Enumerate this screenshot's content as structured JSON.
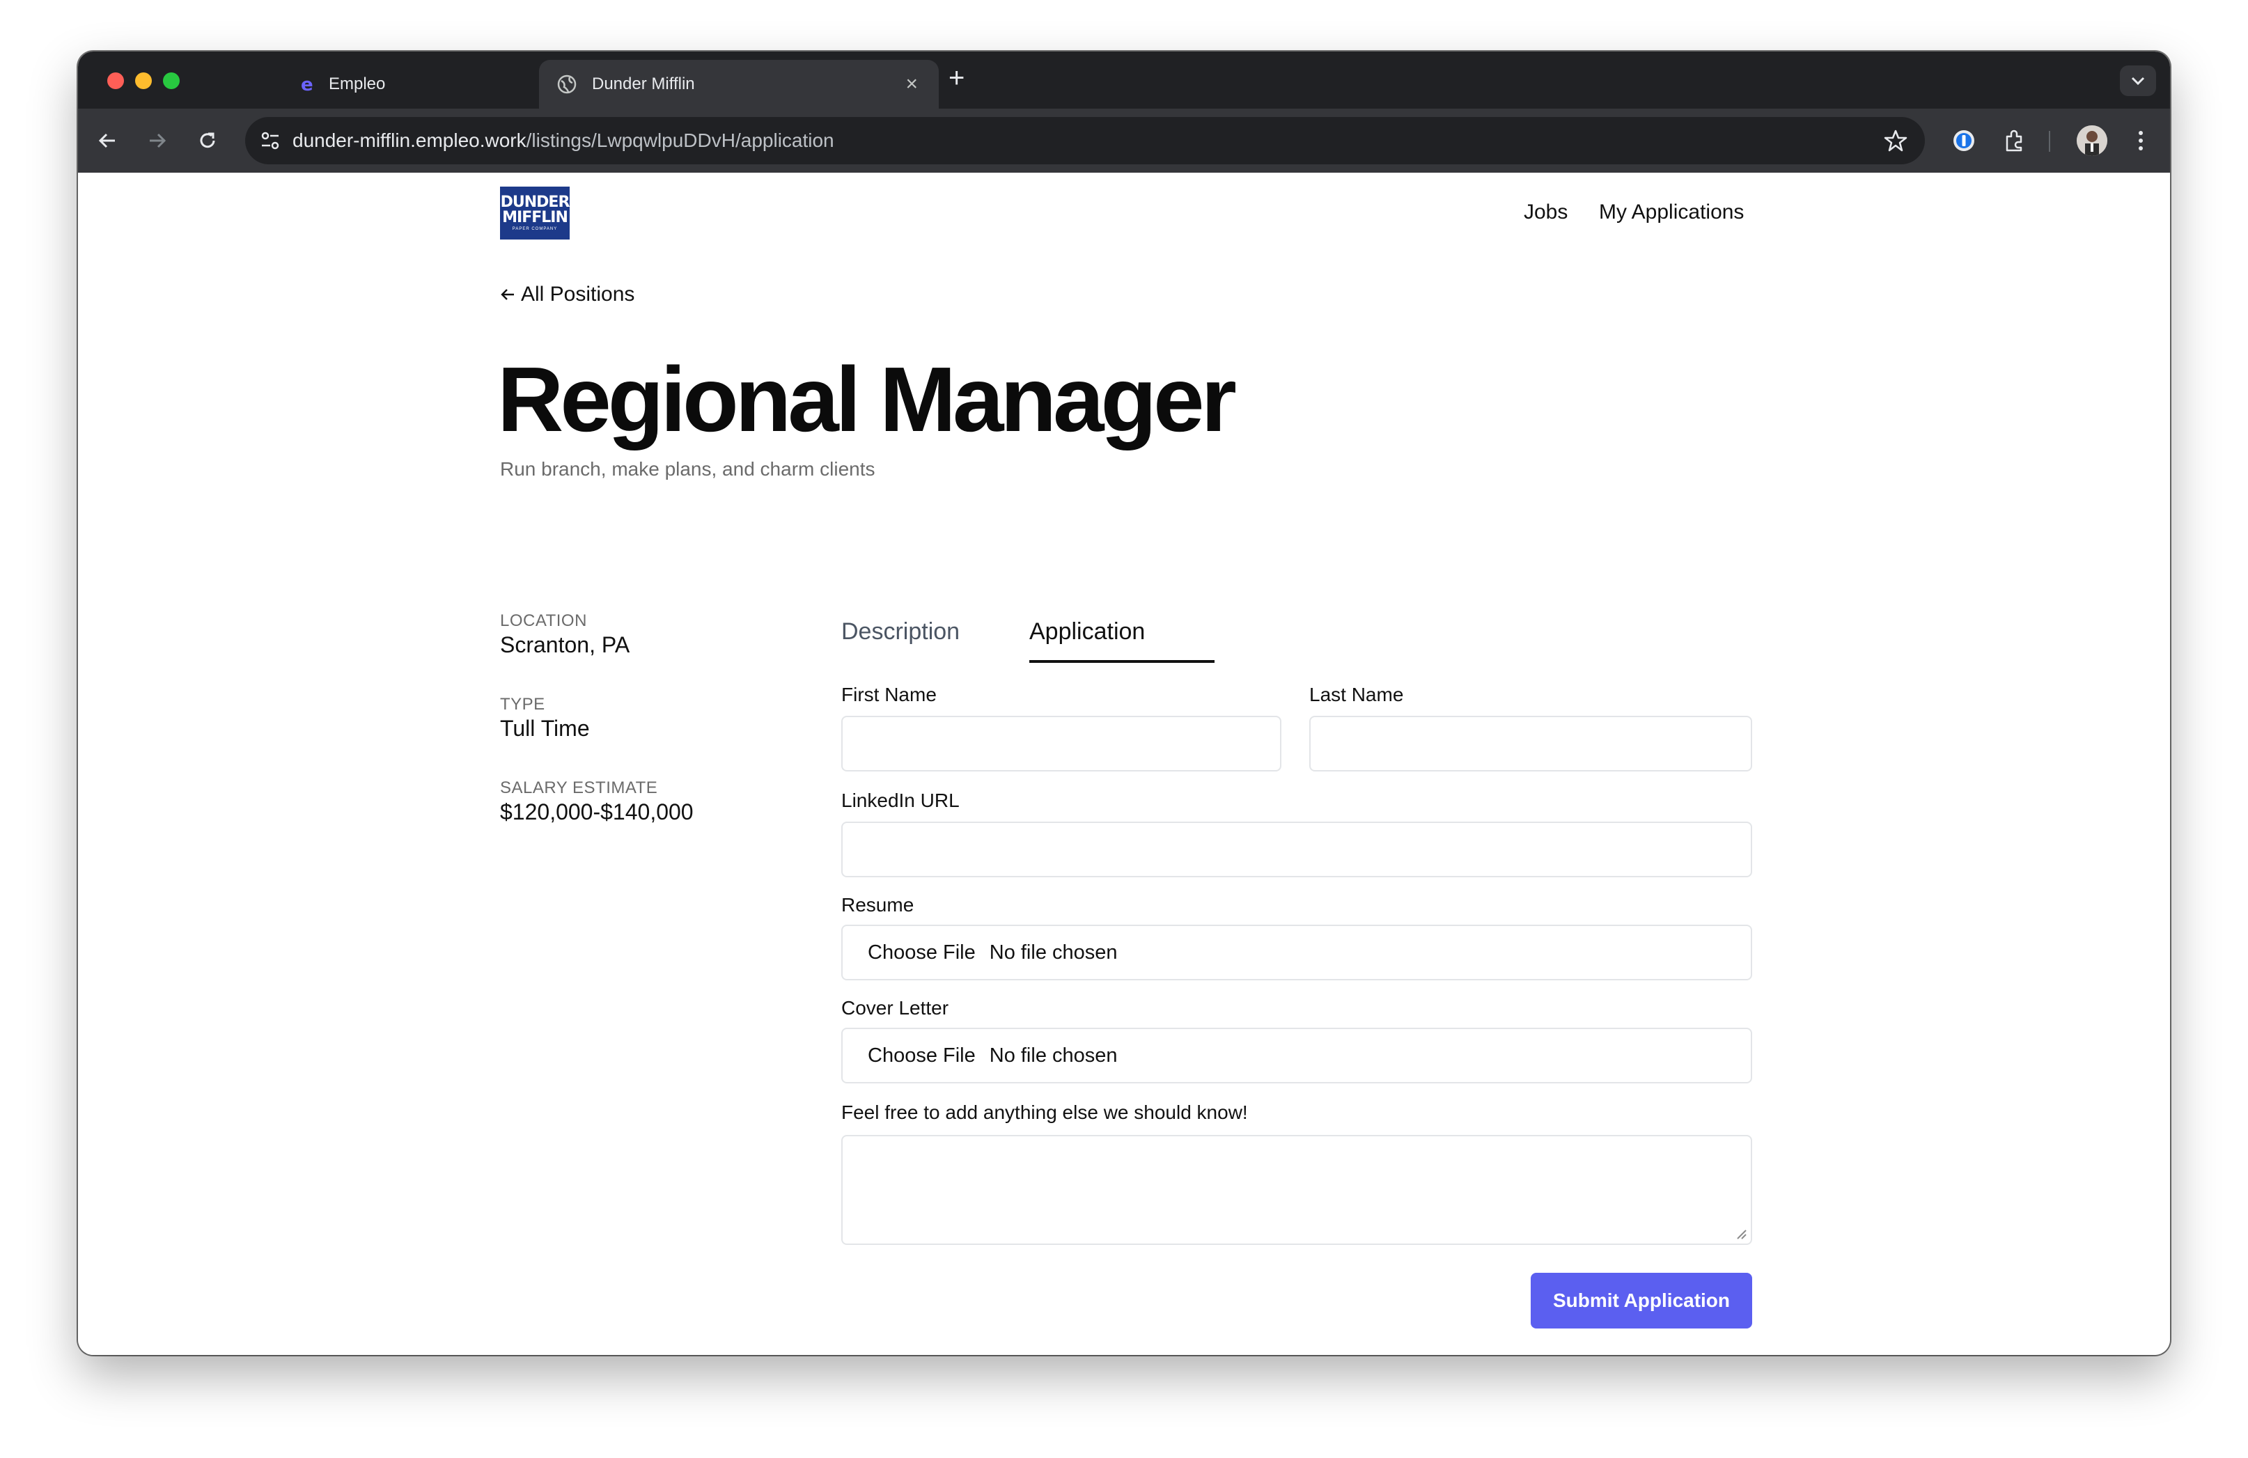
{
  "browser": {
    "tabs": [
      {
        "title": "Empleo",
        "active": false
      },
      {
        "title": "Dunder Mifflin",
        "active": true
      }
    ],
    "url_host": "dunder-mifflin.empleo.work",
    "url_path": "/listings/LwpqwlpuDDvH/application"
  },
  "header": {
    "logo_line1": "DUNDER",
    "logo_line2": "MIFFLIN",
    "logo_line3": "PAPER COMPANY",
    "nav": [
      "Jobs",
      "My Applications"
    ]
  },
  "back_link": "All Positions",
  "job": {
    "title": "Regional Manager",
    "subtitle": "Run branch, make plans, and charm clients"
  },
  "details": [
    {
      "label": "LOCATION",
      "value": "Scranton, PA"
    },
    {
      "label": "TYPE",
      "value": "Tull Time"
    },
    {
      "label": "SALARY ESTIMATE",
      "value": "$120,000-$140,000"
    }
  ],
  "page_tabs": {
    "description": "Description",
    "application": "Application",
    "active": "Application"
  },
  "form": {
    "first_name_label": "First Name",
    "first_name_value": "",
    "last_name_label": "Last Name",
    "last_name_value": "",
    "linkedin_label": "LinkedIn URL",
    "linkedin_value": "",
    "resume_label": "Resume",
    "cover_letter_label": "Cover Letter",
    "choose_file": "Choose File",
    "no_file": "No file chosen",
    "notes_label": "Feel free to add anything else we should know!",
    "notes_value": "",
    "submit_label": "Submit Application"
  },
  "colors": {
    "accent": "#5b5ff0",
    "logo_bg": "#1d3a8a"
  }
}
